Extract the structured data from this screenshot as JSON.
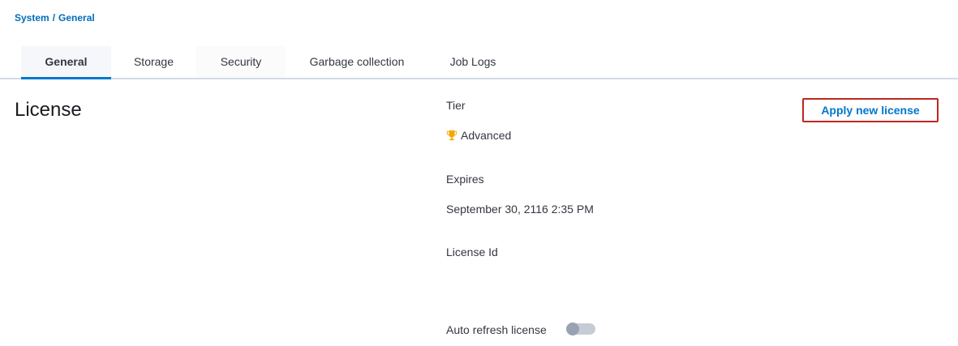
{
  "breadcrumb": {
    "parent": "System",
    "separator": "/",
    "current": "General"
  },
  "tabs": [
    {
      "label": "General",
      "active": true
    },
    {
      "label": "Storage",
      "active": false
    },
    {
      "label": "Security",
      "active": false
    },
    {
      "label": "Garbage collection",
      "active": false
    },
    {
      "label": "Job Logs",
      "active": false
    }
  ],
  "license": {
    "title": "License",
    "tier_label": "Tier",
    "tier_value": "Advanced",
    "tier_icon": "trophy-icon",
    "expires_label": "Expires",
    "expires_value": "September 30, 2116 2:35 PM",
    "license_id_label": "License Id",
    "license_id_value": "",
    "auto_refresh_label": "Auto refresh license",
    "auto_refresh_enabled": false,
    "apply_button_label": "Apply new license"
  },
  "colors": {
    "accent": "#0077cc",
    "breadcrumb": "#006bb8",
    "button_border": "#bd271e",
    "trophy": "#f5a700"
  }
}
